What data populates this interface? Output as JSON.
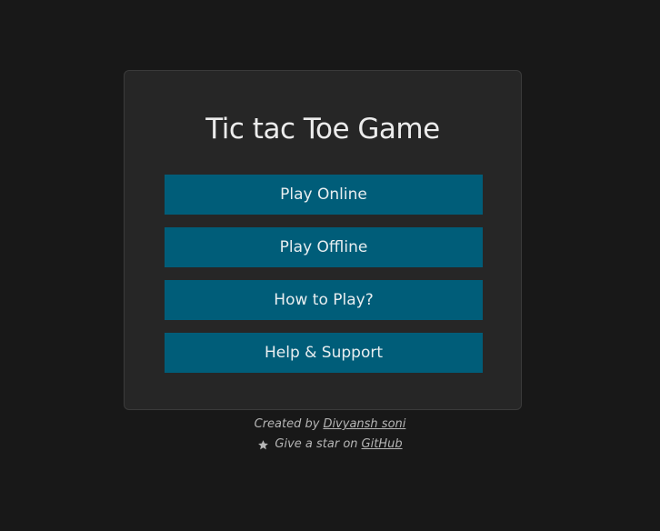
{
  "title": "Tic tac Toe Game",
  "menu": {
    "play_online": "Play Online",
    "play_offline": "Play Offline",
    "how_to_play": "How to Play?",
    "help_support": "Help & Support"
  },
  "footer": {
    "created_by_prefix": "Created by",
    "author_name": "Divyansh soni",
    "star_prefix": "Give a star on",
    "github_label": "GitHub",
    "star_icon": "star-icon"
  },
  "colors": {
    "background": "#181818",
    "card": "#262626",
    "button": "#005d79",
    "text": "#ececec"
  }
}
